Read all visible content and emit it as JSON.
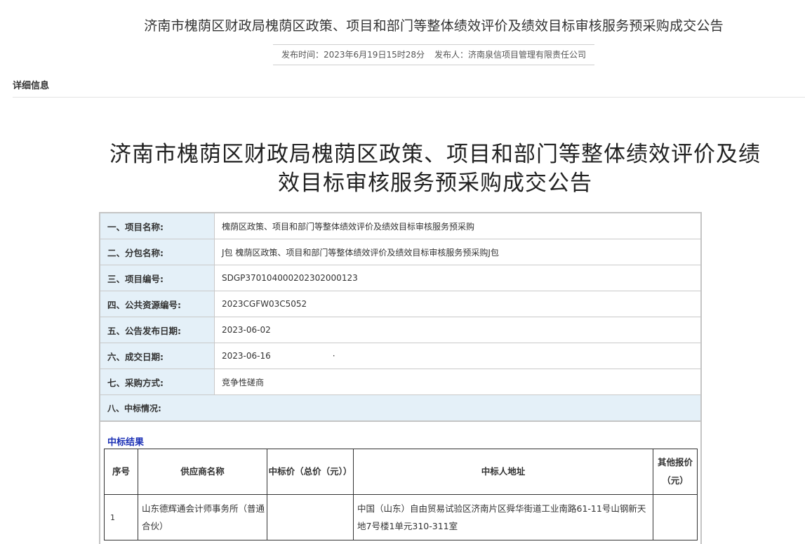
{
  "header": {
    "title": "济南市槐荫区财政局槐荫区政策、项目和部门等整体绩效评价及绩效目标审核服务预采购成交公告",
    "publish_time": "发布时间：2023年6月19日15时28分",
    "publisher": "发布人：济南泉信项目管理有限责任公司"
  },
  "section": {
    "label": "详细信息"
  },
  "document": {
    "title_line1": "济南市槐荫区财政局槐荫区政策、项目和部门等整体绩效评价及绩",
    "title_line2": "效目标审核服务预采购成交公告"
  },
  "info": {
    "rows": [
      {
        "label": "一、项目名称:",
        "value": "槐荫区政策、项目和部门等整体绩效评价及绩效目标审核服务预采购"
      },
      {
        "label": "二、分包名称:",
        "value": "J包 槐荫区政策、项目和部门等整体绩效评价及绩效目标审核服务预采购J包"
      },
      {
        "label": "三、项目编号:",
        "value": "SDGP370104000202302000123"
      },
      {
        "label": "四、公共资源编号:",
        "value": "2023CGFW03C5052"
      },
      {
        "label": "五、公告发布日期:",
        "value": "2023-06-02"
      },
      {
        "label": "六、成交日期:",
        "value": "2023-06-16",
        "extra": "·"
      },
      {
        "label": "七、采购方式:",
        "value": "竞争性磋商"
      }
    ],
    "award_heading": "八、中标情况:"
  },
  "result": {
    "title": "中标结果",
    "headers": {
      "seq": "序号",
      "supplier": "供应商名称",
      "price": "中标价（总价（元））",
      "address": "中标人地址",
      "other": "其他报价（元）"
    },
    "rows": [
      {
        "seq": "1",
        "supplier": "山东德辉通会计师事务所（普通合伙）",
        "price": "",
        "address": "中国（山东）自由贸易试验区济南片区舜华街道工业南路61-11号山钢新天地7号楼1单元310-311室",
        "other": ""
      }
    ]
  }
}
